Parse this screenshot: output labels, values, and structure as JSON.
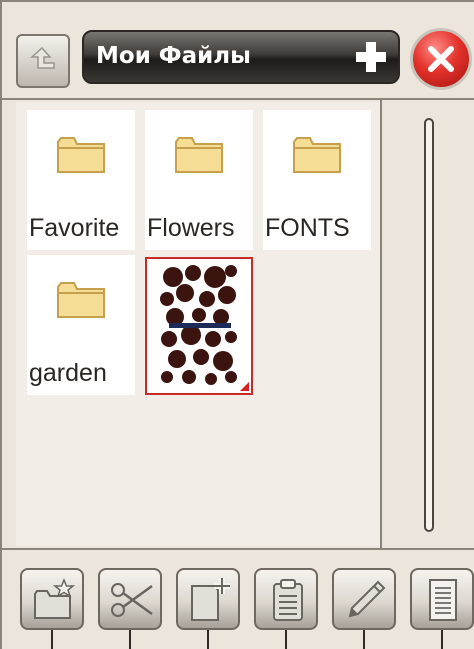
{
  "header": {
    "title": "Мои Файлы",
    "up_icon": "folder-up-icon",
    "new_icon": "plus-icon",
    "close_icon": "close-icon"
  },
  "files": [
    {
      "name": "Favorite",
      "type": "folder"
    },
    {
      "name": "Flowers",
      "type": "folder"
    },
    {
      "name": "FONTS",
      "type": "folder"
    },
    {
      "name": "garden",
      "type": "folder"
    },
    {
      "name": "",
      "type": "embroidery-thumbnail",
      "selected": true
    }
  ],
  "toolbar": {
    "buttons": [
      {
        "icon": "new-folder-star-icon"
      },
      {
        "icon": "scissors-icon"
      },
      {
        "icon": "copy-file-icon"
      },
      {
        "icon": "clipboard-paste-icon"
      },
      {
        "icon": "pencil-rename-icon"
      },
      {
        "icon": "document-info-icon"
      }
    ]
  },
  "colors": {
    "background": "#ece5db",
    "folder": "#f3d98f",
    "close_red": "#e3322c",
    "selection": "#c82a2a",
    "embroidery": "#3b1410",
    "embroidery_stripe": "#1c2a5a"
  }
}
